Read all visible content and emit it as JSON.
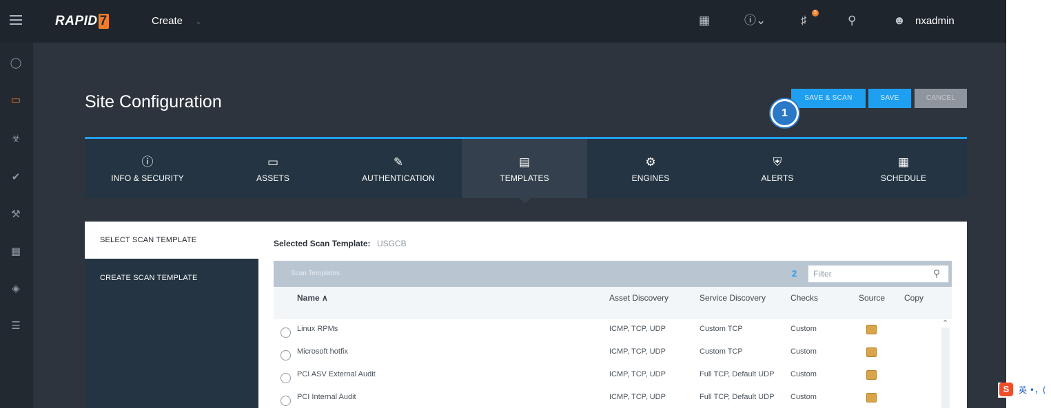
{
  "topbar": {
    "logo": "RAPID",
    "logo_mark": "7",
    "create_label": "Create",
    "notifications_count": "5",
    "username": "nxadmin"
  },
  "page": {
    "title": "Site Configuration",
    "buttons": {
      "save_and_scan": "SAVE & SCAN",
      "save": "SAVE",
      "cancel": "CANCEL"
    },
    "step_marker": "1"
  },
  "tabs": [
    {
      "label": "INFO & SECURITY",
      "icon": "info-icon"
    },
    {
      "label": "ASSETS",
      "icon": "monitor-icon"
    },
    {
      "label": "AUTHENTICATION",
      "icon": "credential-icon"
    },
    {
      "label": "TEMPLATES",
      "icon": "template-icon",
      "active": true
    },
    {
      "label": "ENGINES",
      "icon": "gears-icon"
    },
    {
      "label": "ALERTS",
      "icon": "shield-icon"
    },
    {
      "label": "SCHEDULE",
      "icon": "calendar-icon"
    }
  ],
  "side_menu": {
    "select_scan_template": "SELECT SCAN TEMPLATE",
    "create_scan_template": "CREATE SCAN TEMPLATE"
  },
  "templates": {
    "selected_label": "Selected Scan Template:",
    "selected_value": "USGCB",
    "toolbar_hint": "Scan Templates",
    "count": "2",
    "filter_placeholder": "Filter",
    "columns": {
      "name": "Name ∧",
      "asset_discovery": "Asset Discovery",
      "service_discovery": "Service Discovery",
      "checks": "Checks",
      "source": "Source",
      "copy": "Copy"
    },
    "rows": [
      {
        "name": "Linux RPMs",
        "asset_discovery": "ICMP, TCP, UDP",
        "service_discovery": "Custom TCP",
        "checks": "Custom"
      },
      {
        "name": "Microsoft hotfix",
        "asset_discovery": "ICMP, TCP, UDP",
        "service_discovery": "Custom TCP",
        "checks": "Custom"
      },
      {
        "name": "PCI ASV External Audit",
        "asset_discovery": "ICMP, TCP, UDP",
        "service_discovery": "Full TCP, Default UDP",
        "checks": "Custom"
      },
      {
        "name": "PCI Internal Audit",
        "asset_discovery": "ICMP, TCP, UDP",
        "service_discovery": "Full TCP, Default UDP",
        "checks": "Custom"
      }
    ]
  },
  "ime": {
    "logo": "S",
    "text": "英 •，("
  },
  "colors": {
    "accent": "#1f9ff0",
    "brand_orange": "#f27d29",
    "nav_dark": "#1f252c",
    "tab_bg": "#243442"
  }
}
